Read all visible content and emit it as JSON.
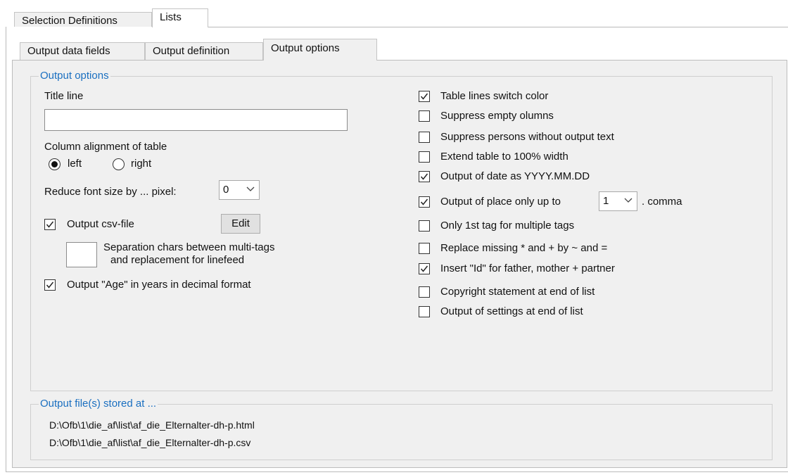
{
  "top_tabs": [
    {
      "label": "Selection Definitions"
    },
    {
      "label": "Lists"
    }
  ],
  "sub_tabs": [
    {
      "label": "Output data fields"
    },
    {
      "label": "Output definition"
    },
    {
      "label": "Output options"
    }
  ],
  "output_options": {
    "legend": "Output options",
    "title_line_label": "Title line",
    "title_line_value": "",
    "column_alignment_label": "Column alignment of table",
    "align_left": "left",
    "align_right": "right",
    "selected_alignment": "left",
    "reduce_font_label": "Reduce font size by ... pixel:",
    "reduce_font_value": "0",
    "output_csv_label": "Output csv-file",
    "output_csv_checked": true,
    "edit_button": "Edit",
    "separation_line1": "Separation chars between multi-tags",
    "separation_line2": "and replacement for linefeed",
    "separation_value": "",
    "output_age_label": "Output \"Age\" in years in decimal format",
    "output_age_checked": true
  },
  "right_options": [
    {
      "label": "Table lines switch color",
      "checked": true
    },
    {
      "label": "Suppress empty olumns",
      "checked": false
    },
    {
      "label": "Suppress persons without output text",
      "checked": false
    },
    {
      "label": "Extend table to 100% width",
      "checked": false
    },
    {
      "label": "Output of date as YYYY.MM.DD",
      "checked": true
    },
    {
      "label": "Output of place only up to",
      "checked": true,
      "combo_value": "1",
      "suffix": ". comma"
    },
    {
      "label": "Only 1st tag for multiple tags",
      "checked": false
    },
    {
      "label": "Replace missing * and + by ~ and =",
      "checked": false
    },
    {
      "label": "Insert \"Id\" for father, mother + partner",
      "checked": true
    },
    {
      "label": "Copyright statement at end of list",
      "checked": false
    },
    {
      "label": "Output of settings at end of list",
      "checked": false
    }
  ],
  "output_files": {
    "legend": "Output file(s) stored at ...",
    "paths": [
      "D:\\Ofb\\1\\die_af\\list\\af_die_Elternalter-dh-p.html",
      "D:\\Ofb\\1\\die_af\\list\\af_die_Elternalter-dh-p.csv"
    ]
  }
}
